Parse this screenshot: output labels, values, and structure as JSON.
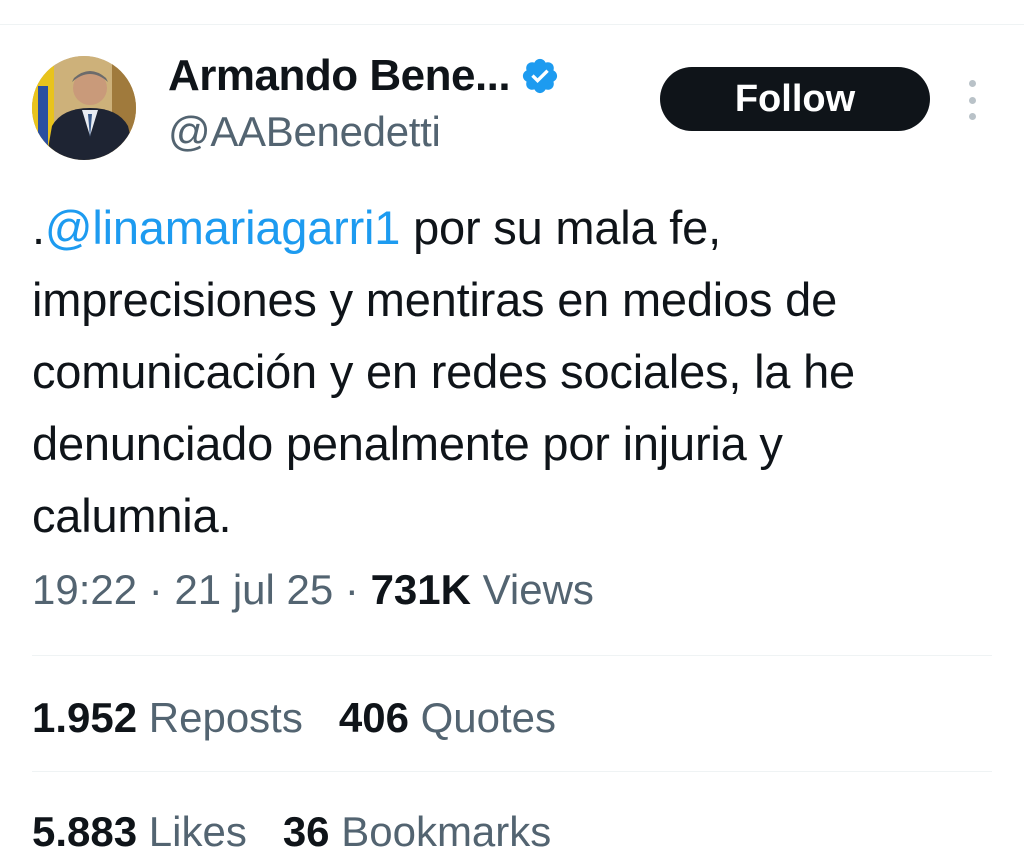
{
  "author": {
    "display_name": "Armando Bene...",
    "handle": "@AABenedetti",
    "verified_icon": "verified-badge-icon",
    "verified_color": "#1d9bf0"
  },
  "actions": {
    "follow_label": "Follow",
    "more_icon": "more-vertical-icon"
  },
  "tweet": {
    "prefix": ".",
    "mention": "@linamariagarri1",
    "body": " por su mala fe, imprecisiones y mentiras en medios de comunicación y en redes sociales, la he denunciado penalmente por injuria y calumnia."
  },
  "meta": {
    "time": "19:22",
    "sep1": " · ",
    "date": "21 jul 25",
    "sep2": " · ",
    "views_count": "731K",
    "views_label": " Views"
  },
  "stats": {
    "reposts_count": "1.952",
    "reposts_label": " Reposts",
    "quotes_count": "406",
    "quotes_label": " Quotes",
    "likes_count": "5.883",
    "likes_label": " Likes",
    "bookmarks_count": "36",
    "bookmarks_label": " Bookmarks"
  },
  "colors": {
    "text_primary": "#0f1419",
    "text_secondary": "#536471",
    "link": "#1d9bf0",
    "follow_bg": "#0f1419"
  }
}
